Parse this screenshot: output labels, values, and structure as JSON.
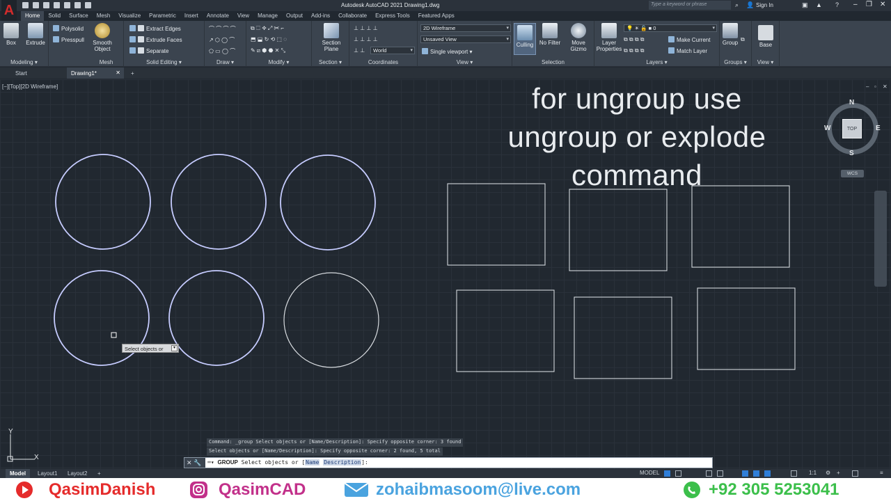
{
  "app": {
    "title": "Autodesk AutoCAD 2021    Drawing1.dwg",
    "search_placeholder": "Type a keyword or phrase",
    "sign_in": "Sign In",
    "logo": "A"
  },
  "ribbon_tabs": [
    "Home",
    "Solid",
    "Surface",
    "Mesh",
    "Visualize",
    "Parametric",
    "Insert",
    "Annotate",
    "View",
    "Manage",
    "Output",
    "Add-ins",
    "Collaborate",
    "Express Tools",
    "Featured Apps"
  ],
  "ribbon": {
    "modeling": {
      "title": "Modeling ▾",
      "box": "Box",
      "extrude": "Extrude",
      "polysolid": "Polysolid",
      "presspull": "Presspull"
    },
    "mesh": {
      "title": "Mesh",
      "smooth": "Smooth Object"
    },
    "solid_editing": {
      "title": "Solid Editing ▾",
      "extract": "Extract Edges",
      "extrude_faces": "Extrude Faces",
      "separate": "Separate"
    },
    "draw": {
      "title": "Draw ▾"
    },
    "modify": {
      "title": "Modify ▾"
    },
    "section": {
      "title": "Section ▾",
      "plane": "Section Plane"
    },
    "coordinates": {
      "title": "Coordinates",
      "world": "World"
    },
    "view": {
      "title": "View ▾",
      "visual_style": "2D Wireframe",
      "saved_view": "Unsaved View",
      "viewport": "Single viewport"
    },
    "selection": {
      "title": "Selection",
      "culling": "Culling",
      "no_filter": "No Filter",
      "move_gizmo": "Move Gizmo"
    },
    "layers": {
      "title": "Layers ▾",
      "layer_props": "Layer Properties",
      "current_layer": "0",
      "make_current": "Make Current",
      "match_layer": "Match Layer"
    },
    "groups": {
      "title": "Groups ▾",
      "group": "Group"
    },
    "view2": {
      "title": "View ▾",
      "base": "Base"
    }
  },
  "file_tabs": [
    "Start",
    "Drawing1*"
  ],
  "viewport_label": "[−][Top][2D Wireframe]",
  "overlay_lines": [
    "for ungroup use",
    "ungroup or explode",
    "command"
  ],
  "tooltip": "Select objects or",
  "viewcube": {
    "n": "N",
    "s": "S",
    "e": "E",
    "w": "W",
    "top": "TOP",
    "wcs": "WCS"
  },
  "ucs": {
    "x": "X",
    "y": "Y"
  },
  "command_history": [
    "Command:  _group Select objects or [Name/Description]: Specify opposite corner: 3 found",
    "Select objects or [Name/Description]: Specify opposite corner: 2 found, 5 total"
  ],
  "command": {
    "keyword": "GROUP",
    "text": "Select objects or [",
    "opt1": "Name",
    "opt2": "Description",
    "tail": "]:"
  },
  "layout_tabs": [
    "Model",
    "Layout1",
    "Layout2"
  ],
  "status": {
    "model": "MODEL",
    "scale": "1:1"
  },
  "watermark": {
    "youtube": "QasimDanish",
    "instagram": "QasimCAD",
    "email": "zohaibmasoom@live.com",
    "phone": "+92 305 5253041"
  },
  "colors": {
    "youtube": "#e52b2b",
    "instagram": "#c2308a",
    "email": "#4aa3df",
    "whatsapp": "#3cbf4b"
  }
}
